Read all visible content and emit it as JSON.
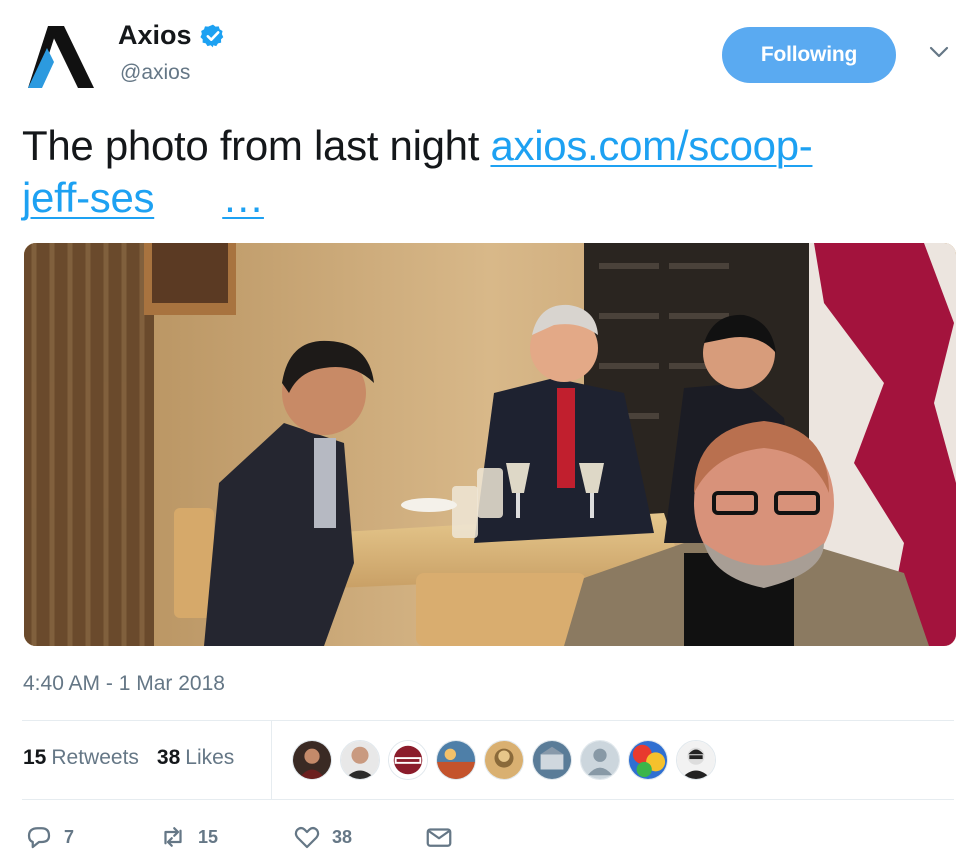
{
  "account": {
    "display_name": "Axios",
    "handle": "@axios",
    "verified": true,
    "avatar_icon": "axios-logo-icon",
    "verified_icon": "verified-badge-icon"
  },
  "follow_button": {
    "label": "Following"
  },
  "menu": {
    "icon": "chevron-down-icon"
  },
  "tweet": {
    "text": "The photo from last night ",
    "link_line1": "axios.com/scoop-",
    "link_line2": "jeff-ses",
    "ellipsis": "…",
    "timestamp": "4:40 AM - 1 Mar 2018"
  },
  "stats": {
    "retweets_count": "15",
    "retweets_label": "Retweets",
    "likes_count": "38",
    "likes_label": "Likes"
  },
  "likers": {
    "count": 9
  },
  "actions": {
    "reply_count": "7",
    "retweet_count": "15",
    "like_count": "38",
    "reply_icon": "reply-icon",
    "retweet_icon": "retweet-icon",
    "like_icon": "heart-icon",
    "dm_icon": "envelope-icon"
  },
  "colors": {
    "accent": "#1da1f2",
    "follow_bg": "#5aaaf1",
    "muted": "#657786",
    "text": "#14171a"
  }
}
